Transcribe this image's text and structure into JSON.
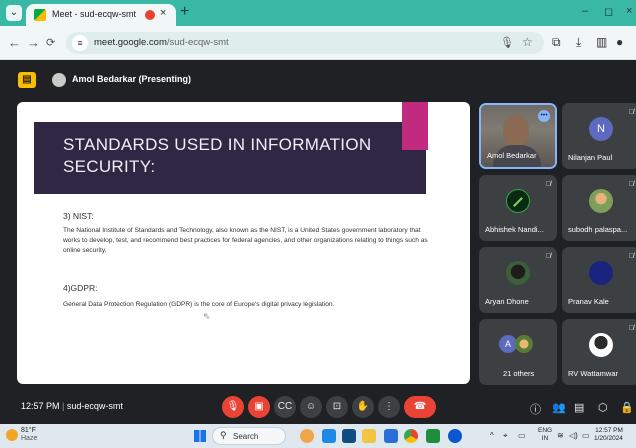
{
  "browser": {
    "tab_title": "Meet - sud-ecqw-smt",
    "tab_close": "×",
    "new_tab": "+",
    "url_domain": "meet.google.com",
    "url_path": "/sud-ecqw-smt"
  },
  "meet": {
    "presenter_label": "Amol Bedarkar (Presenting)",
    "time": "12:57 PM",
    "separator": "|",
    "meeting_code": "sud-ecqw-smt"
  },
  "slide": {
    "heading_line1": "STANDARDS USED IN INFORMATION",
    "heading_line2": "SECURITY:",
    "sections": [
      {
        "title": "3) NIST:",
        "body": "The National Institute of Standards and Technology, also known as the NIST, is a United States government laboratory that works to develop, test, and recommend best practices for federal agencies, and other organizations relating to things such as online security."
      },
      {
        "title": "4)GDPR:",
        "body": "General Data Protection Regulation (GDPR) is the core of Europe's digital privacy legislation."
      }
    ]
  },
  "participants": [
    {
      "name": "Amol Bedarkar",
      "speaking": true
    },
    {
      "name": "Nilanjan Paul",
      "initial": "N",
      "color": "#5c6bc0"
    },
    {
      "name": "Abhishek Nandi..."
    },
    {
      "name": "subodh palaspa..."
    },
    {
      "name": "Aryan Dhone"
    },
    {
      "name": "Pranav Kale",
      "color": "#1a237e"
    },
    {
      "name": "21 others",
      "initial": "A"
    },
    {
      "name": "RV Wattamwar"
    }
  ],
  "taskbar": {
    "temperature": "81°F",
    "condition": "Haze",
    "search_label": "Search",
    "lang_line1": "ENG",
    "lang_line2": "IN",
    "clock_time": "12:57 PM",
    "clock_date": "1/20/2024"
  },
  "colors": {
    "browser_accent": "#3ab8a6",
    "slide_band": "#2f2744",
    "slide_accent": "#c22a7f",
    "end_call": "#ea4335"
  }
}
